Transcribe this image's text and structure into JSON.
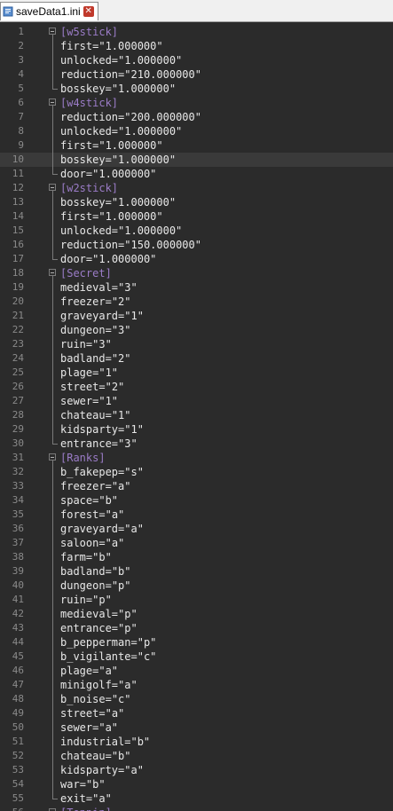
{
  "tab": {
    "icon": "ini-file-icon",
    "label": "saveData1.ini",
    "close_icon": "close-icon"
  },
  "colors": {
    "section": "#9b7cc7",
    "text": "#e8e8e8",
    "line_number": "#8a8a8a",
    "background": "#2b2b2b"
  },
  "current_line": 10,
  "lines": [
    {
      "n": "1",
      "section": "[w5stick]"
    },
    {
      "n": "2",
      "key": "first",
      "value": "\"1.000000\""
    },
    {
      "n": "3",
      "key": "unlocked",
      "value": "\"1.000000\""
    },
    {
      "n": "4",
      "key": "reduction",
      "value": "\"210.000000\""
    },
    {
      "n": "5",
      "key": "bosskey",
      "value": "\"1.000000\""
    },
    {
      "n": "6",
      "section": "[w4stick]"
    },
    {
      "n": "7",
      "key": "reduction",
      "value": "\"200.000000\""
    },
    {
      "n": "8",
      "key": "unlocked",
      "value": "\"1.000000\""
    },
    {
      "n": "9",
      "key": "first",
      "value": "\"1.000000\""
    },
    {
      "n": "10",
      "key": "bosskey",
      "value": "\"1.000000\""
    },
    {
      "n": "11",
      "key": "door",
      "value": "\"1.000000\""
    },
    {
      "n": "12",
      "section": "[w2stick]"
    },
    {
      "n": "13",
      "key": "bosskey",
      "value": "\"1.000000\""
    },
    {
      "n": "14",
      "key": "first",
      "value": "\"1.000000\""
    },
    {
      "n": "15",
      "key": "unlocked",
      "value": "\"1.000000\""
    },
    {
      "n": "16",
      "key": "reduction",
      "value": "\"150.000000\""
    },
    {
      "n": "17",
      "key": "door",
      "value": "\"1.000000\""
    },
    {
      "n": "18",
      "section": "[Secret]"
    },
    {
      "n": "19",
      "key": "medieval",
      "value": "\"3\""
    },
    {
      "n": "20",
      "key": "freezer",
      "value": "\"2\""
    },
    {
      "n": "21",
      "key": "graveyard",
      "value": "\"1\""
    },
    {
      "n": "22",
      "key": "dungeon",
      "value": "\"3\""
    },
    {
      "n": "23",
      "key": "ruin",
      "value": "\"3\""
    },
    {
      "n": "24",
      "key": "badland",
      "value": "\"2\""
    },
    {
      "n": "25",
      "key": "plage",
      "value": "\"1\""
    },
    {
      "n": "26",
      "key": "street",
      "value": "\"2\""
    },
    {
      "n": "27",
      "key": "sewer",
      "value": "\"1\""
    },
    {
      "n": "28",
      "key": "chateau",
      "value": "\"1\""
    },
    {
      "n": "29",
      "key": "kidsparty",
      "value": "\"1\""
    },
    {
      "n": "30",
      "key": "entrance",
      "value": "\"3\""
    },
    {
      "n": "31",
      "section": "[Ranks]"
    },
    {
      "n": "32",
      "key": "b_fakepep",
      "value": "\"s\""
    },
    {
      "n": "33",
      "key": "freezer",
      "value": "\"a\""
    },
    {
      "n": "34",
      "key": "space",
      "value": "\"b\""
    },
    {
      "n": "35",
      "key": "forest",
      "value": "\"a\""
    },
    {
      "n": "36",
      "key": "graveyard",
      "value": "\"a\""
    },
    {
      "n": "37",
      "key": "saloon",
      "value": "\"a\""
    },
    {
      "n": "38",
      "key": "farm",
      "value": "\"b\""
    },
    {
      "n": "39",
      "key": "badland",
      "value": "\"b\""
    },
    {
      "n": "40",
      "key": "dungeon",
      "value": "\"p\""
    },
    {
      "n": "41",
      "key": "ruin",
      "value": "\"p\""
    },
    {
      "n": "42",
      "key": "medieval",
      "value": "\"p\""
    },
    {
      "n": "43",
      "key": "entrance",
      "value": "\"p\""
    },
    {
      "n": "44",
      "key": "b_pepperman",
      "value": "\"p\""
    },
    {
      "n": "45",
      "key": "b_vigilante",
      "value": "\"c\""
    },
    {
      "n": "46",
      "key": "plage",
      "value": "\"a\""
    },
    {
      "n": "47",
      "key": "minigolf",
      "value": "\"a\""
    },
    {
      "n": "48",
      "key": "b_noise",
      "value": "\"c\""
    },
    {
      "n": "49",
      "key": "street",
      "value": "\"a\""
    },
    {
      "n": "50",
      "key": "sewer",
      "value": "\"a\""
    },
    {
      "n": "51",
      "key": "industrial",
      "value": "\"b\""
    },
    {
      "n": "52",
      "key": "chateau",
      "value": "\"b\""
    },
    {
      "n": "53",
      "key": "kidsparty",
      "value": "\"a\""
    },
    {
      "n": "54",
      "key": "war",
      "value": "\"b\""
    },
    {
      "n": "55",
      "key": "exit",
      "value": "\"a\""
    },
    {
      "n": "56",
      "section": "[Toppin]"
    }
  ]
}
